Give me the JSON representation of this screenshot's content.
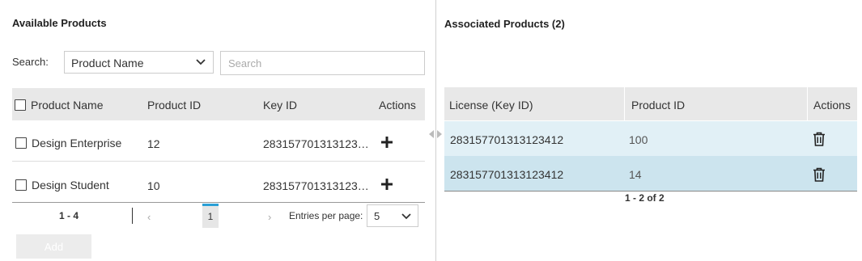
{
  "available": {
    "title": "Available Products",
    "search_label": "Search:",
    "search_field": "Product Name",
    "search_placeholder": "Search",
    "columns": [
      "Product Name",
      "Product ID",
      "Key ID",
      "Actions"
    ],
    "rows": [
      {
        "name": "Design Enterprise",
        "id": "12",
        "key": "283157701313123…"
      },
      {
        "name": "Design Student",
        "id": "10",
        "key": "283157701313123…"
      }
    ],
    "pager": {
      "range": "1 - 4",
      "prev": "‹",
      "next": "›",
      "page": "1",
      "entries_label": "Entries per page:",
      "entries_value": "5"
    },
    "add_label": "Add"
  },
  "associated": {
    "title": "Associated Products (2)",
    "columns": [
      "License (Key ID)",
      "Product ID",
      "Actions"
    ],
    "rows": [
      {
        "license": "283157701313123412",
        "id": "100"
      },
      {
        "license": "283157701313123412",
        "id": "14"
      }
    ],
    "pager_range": "1 - 2 of 2"
  },
  "colors": {
    "header_bg": "#e8e8e8",
    "row_light": "#e1f0f6",
    "row_selected": "#cce4ee",
    "accent": "#2aa0d6"
  },
  "icons": [
    "chevron-down-icon",
    "plus-icon",
    "trash-icon",
    "splitter-arrows-icon"
  ]
}
